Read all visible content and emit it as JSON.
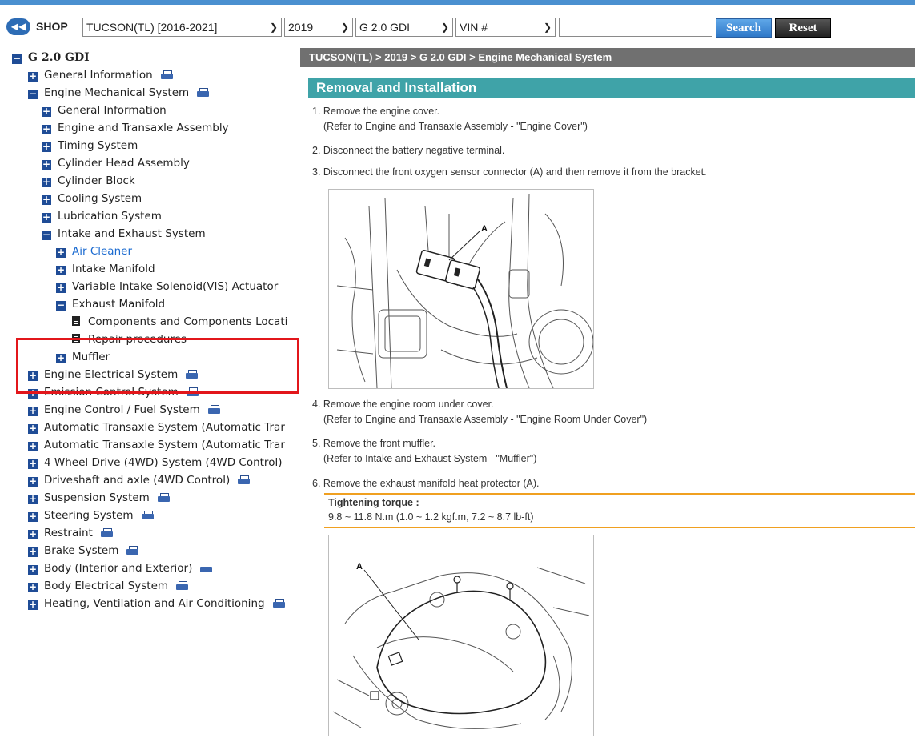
{
  "toolbar": {
    "back_glyph": "◀◀",
    "shop_label": "SHOP",
    "model": "TUCSON(TL) [2016-2021]",
    "year": "2019",
    "engine": "G 2.0 GDI",
    "vin": "VIN #",
    "search_value": "",
    "search_label": "Search",
    "reset_label": "Reset"
  },
  "tree": [
    {
      "label": "G 2.0 GDI",
      "state": "minus",
      "level": 0,
      "print": false
    },
    {
      "label": "General Information",
      "state": "plus",
      "level": 1,
      "print": true
    },
    {
      "label": "Engine Mechanical System",
      "state": "minus",
      "level": 1,
      "print": true
    },
    {
      "label": "General Information",
      "state": "plus",
      "level": 2,
      "print": false
    },
    {
      "label": "Engine and Transaxle Assembly",
      "state": "plus",
      "level": 2,
      "print": false
    },
    {
      "label": "Timing System",
      "state": "plus",
      "level": 2,
      "print": false
    },
    {
      "label": "Cylinder Head Assembly",
      "state": "plus",
      "level": 2,
      "print": false
    },
    {
      "label": "Cylinder Block",
      "state": "plus",
      "level": 2,
      "print": false
    },
    {
      "label": "Cooling System",
      "state": "plus",
      "level": 2,
      "print": false
    },
    {
      "label": "Lubrication System",
      "state": "plus",
      "level": 2,
      "print": false
    },
    {
      "label": "Intake and Exhaust System",
      "state": "minus",
      "level": 2,
      "print": false
    },
    {
      "label": "Air Cleaner",
      "state": "plus",
      "level": 3,
      "print": false,
      "link": true
    },
    {
      "label": "Intake Manifold",
      "state": "plus",
      "level": 3,
      "print": false
    },
    {
      "label": "Variable Intake Solenoid(VIS) Actuator",
      "state": "plus",
      "level": 3,
      "print": false
    },
    {
      "label": "Exhaust Manifold",
      "state": "minus",
      "level": 3,
      "print": false
    },
    {
      "label": "Components and Components Locati",
      "state": "doc",
      "level": 4,
      "print": false
    },
    {
      "label": "Repair procedures",
      "state": "doc",
      "level": 4,
      "print": false
    },
    {
      "label": "Muffler",
      "state": "plus",
      "level": 3,
      "print": false
    },
    {
      "label": "Engine Electrical System",
      "state": "plus",
      "level": 1,
      "print": true
    },
    {
      "label": "Emission Control System",
      "state": "plus",
      "level": 1,
      "print": true
    },
    {
      "label": "Engine Control / Fuel System",
      "state": "plus",
      "level": 1,
      "print": true
    },
    {
      "label": "Automatic Transaxle System (Automatic Trar",
      "state": "plus",
      "level": 1,
      "print": false
    },
    {
      "label": "Automatic Transaxle System (Automatic Trar",
      "state": "plus",
      "level": 1,
      "print": false
    },
    {
      "label": "4 Wheel Drive (4WD) System (4WD Control)",
      "state": "plus",
      "level": 1,
      "print": false
    },
    {
      "label": "Driveshaft and axle (4WD Control)",
      "state": "plus",
      "level": 1,
      "print": true
    },
    {
      "label": "Suspension System",
      "state": "plus",
      "level": 1,
      "print": true
    },
    {
      "label": "Steering System",
      "state": "plus",
      "level": 1,
      "print": true
    },
    {
      "label": "Restraint",
      "state": "plus",
      "level": 1,
      "print": true
    },
    {
      "label": "Brake System",
      "state": "plus",
      "level": 1,
      "print": true
    },
    {
      "label": "Body (Interior and Exterior)",
      "state": "plus",
      "level": 1,
      "print": true
    },
    {
      "label": "Body Electrical System",
      "state": "plus",
      "level": 1,
      "print": true
    },
    {
      "label": "Heating, Ventilation and Air Conditioning",
      "state": "plus",
      "level": 1,
      "print": true
    }
  ],
  "content": {
    "breadcrumb": "TUCSON(TL) > 2019 > G 2.0 GDI > Engine Mechanical System",
    "title": "Removal and Installation",
    "steps": [
      {
        "text": "1. Remove the engine cover.",
        "sub": "(Refer to Engine and Transaxle Assembly - \"Engine Cover\")"
      },
      {
        "text": "2. Disconnect the battery negative terminal.",
        "sub": ""
      },
      {
        "text": "3. Disconnect the front oxygen sensor connector (A) and then remove it from the bracket.",
        "sub": ""
      },
      {
        "text": "4. Remove the engine room under cover.",
        "sub": "(Refer to Engine and Transaxle Assembly - \"Engine Room Under Cover\")"
      },
      {
        "text": "5. Remove the front muffler.",
        "sub": "(Refer to Intake and Exhaust System - \"Muffler\")"
      },
      {
        "text": "6. Remove the exhaust manifold heat protector (A).",
        "sub": ""
      }
    ],
    "torque_title": "Tightening torque :",
    "torque_value": "9.8 ~ 11.8 N.m (1.0 ~ 1.2 kgf.m, 7.2 ~ 8.7 lb-ft)",
    "figure1_label": "A",
    "figure2_label": "A"
  }
}
